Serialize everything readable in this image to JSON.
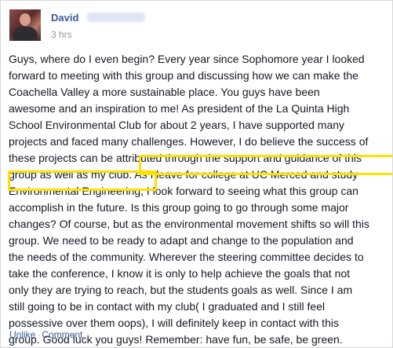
{
  "post": {
    "author": "David",
    "timestamp": "3 hrs",
    "lines": [
      "Guys, where do I even begin? Every year since Sophomore year I looked",
      "forward to meeting with this group and discussing how we can make the",
      "Coachella Valley a more sustainable place. You guys have been",
      "awesome and an inspiration to me! As president of the La Quinta High",
      "School Environmental Club for about 2 years, I have supported many",
      "projects and faced many challenges. However, I do believe the success of",
      "these projects can be attributed through the support and guidance of this",
      "group as well as my club. As I leave for college at UC Merced and study",
      "Environmental Engineering, I look forward to seeing what this group can",
      "accomplish in the future. Is this group going to go through some major",
      "changes? Of course, but as the environmental movement shifts so will this",
      "group. We need to be ready to adapt and change to the population and",
      "the needs of the community. Wherever the steering committee decides to",
      "take the conference, I know it is only to help achieve the goals that not",
      "only they are trying to reach, but the students goals as well. Since I am",
      "still going to be in contact with my club( I graduated and I still feel",
      "possessive over them oops), I will definitely keep in contact with this",
      "group. Good luck you guys! Remember: have fun, be safe, be green."
    ]
  },
  "actions": {
    "unlike": "Unlike",
    "separator": "·",
    "comment": "Comment"
  },
  "colors": {
    "link": "#3b5998",
    "meta": "#9197a3",
    "highlight": "#ffe100"
  }
}
